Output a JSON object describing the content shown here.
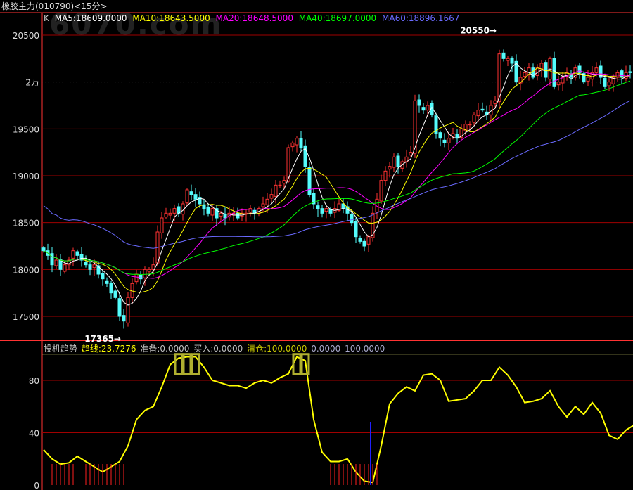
{
  "header": {
    "title": "橡胶主力(010790)<15分>"
  },
  "watermark": "6070.com",
  "main_legend": {
    "k": "K",
    "ma5": "MA5:18609.0000",
    "ma10": "MA10:18643.5000",
    "ma20": "MA20:18648.5000",
    "ma40": "MA40:18697.0000",
    "ma60": "MA60:18896.1667"
  },
  "indicator_legend": {
    "name": "投机趋势",
    "trend": "趋线:23.7276",
    "prepare": "准备:0.0000",
    "buy": "买入:0.0000",
    "clear": "清仓:100.0000",
    "v1": "0.0000",
    "v2": "100.0000"
  },
  "colors": {
    "up": "#ff3232",
    "down": "#54fcfc",
    "ma5": "#ffffff",
    "ma10": "#ffff00",
    "ma20": "#ff00ff",
    "ma40": "#00ff00",
    "ma60": "#6a6aff",
    "grid": "#a00000",
    "axis": "#ff3232",
    "trend": "#ffff00"
  },
  "chart_data": [
    {
      "type": "candlestick",
      "title": "橡胶主力(010790)<15分>",
      "ylim": [
        17250,
        20900
      ],
      "yticks": [
        {
          "v": 20500,
          "label": "20500"
        },
        {
          "v": 20000,
          "label": "2万"
        },
        {
          "v": 19500,
          "label": "19500"
        },
        {
          "v": 19000,
          "label": "19000"
        },
        {
          "v": 18500,
          "label": "18500"
        },
        {
          "v": 18000,
          "label": "18000"
        },
        {
          "v": 17500,
          "label": "17500"
        }
      ],
      "annotations": [
        {
          "label": "20550",
          "value": 20550,
          "index": 108
        },
        {
          "label": "17365",
          "value": 17365,
          "index": 19
        }
      ],
      "close": [
        18200,
        18150,
        18050,
        18100,
        18000,
        18050,
        18100,
        18200,
        18150,
        18100,
        18050,
        18000,
        18050,
        17950,
        17900,
        17850,
        17750,
        17700,
        17500,
        17450,
        17700,
        17850,
        17950,
        17900,
        18000,
        18000,
        18050,
        18400,
        18550,
        18600,
        18600,
        18650,
        18600,
        18700,
        18850,
        18800,
        18750,
        18700,
        18650,
        18600,
        18650,
        18550,
        18600,
        18550,
        18600,
        18600,
        18550,
        18600,
        18600,
        18650,
        18600,
        18650,
        18700,
        18750,
        18800,
        18900,
        18900,
        18950,
        19300,
        19350,
        19400,
        19300,
        19100,
        18800,
        18700,
        18650,
        18600,
        18650,
        18600,
        18650,
        18700,
        18650,
        18600,
        18500,
        18350,
        18300,
        18250,
        18350,
        18600,
        18750,
        18950,
        19050,
        19100,
        19200,
        19100,
        19150,
        19200,
        19250,
        19800,
        19750,
        19700,
        19750,
        19650,
        19450,
        19400,
        19350,
        19400,
        19450,
        19400,
        19500,
        19550,
        19550,
        19650,
        19700,
        19700,
        19650,
        19750,
        19800,
        20300,
        20250,
        20250,
        20200,
        20000,
        20050,
        20100,
        20150,
        20050,
        20150,
        20200,
        20050,
        20250,
        19950,
        20000,
        20050,
        20100,
        20050,
        20150,
        20100,
        20000,
        20050,
        20100,
        20150,
        20050,
        19950,
        20000,
        20050,
        20100,
        20050,
        20100,
        20100
      ]
    },
    {
      "type": "line",
      "title": "投机趋势",
      "ylim": [
        0,
        100
      ],
      "yticks": [
        {
          "v": 80,
          "label": "80"
        },
        {
          "v": 40,
          "label": "40"
        },
        {
          "v": 0,
          "label": "0"
        }
      ],
      "index_step": 2,
      "trend": [
        27,
        20,
        16,
        17,
        22,
        18,
        14,
        10,
        14,
        18,
        30,
        50,
        57,
        60,
        75,
        92,
        97,
        98,
        98,
        90,
        80,
        78,
        76,
        76,
        74,
        78,
        80,
        78,
        82,
        85,
        98,
        95,
        50,
        25,
        18,
        18,
        20,
        10,
        3,
        2,
        30,
        62,
        70,
        75,
        72,
        84,
        85,
        80,
        64,
        65,
        66,
        72,
        80,
        80,
        90,
        84,
        75,
        63,
        64,
        66,
        72,
        60,
        52,
        60,
        54,
        63,
        55,
        38,
        35,
        42,
        46
      ]
    }
  ]
}
